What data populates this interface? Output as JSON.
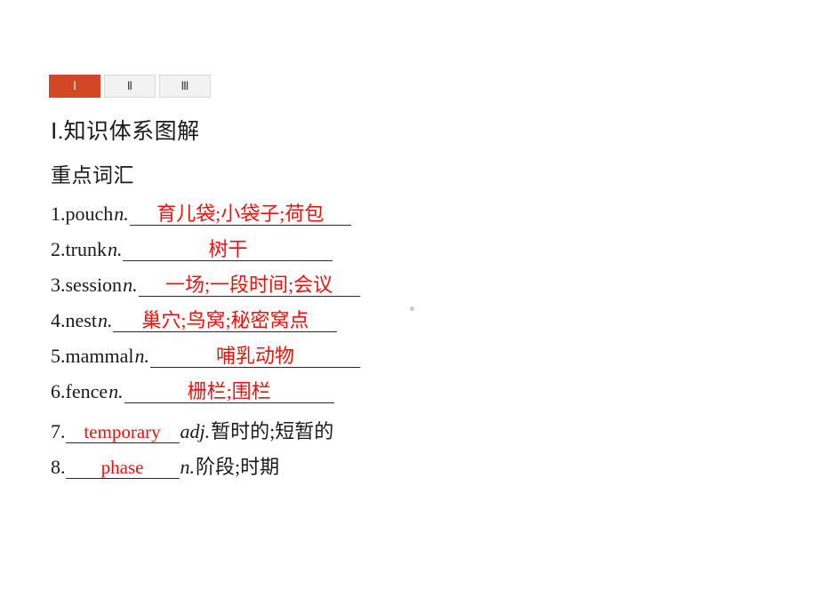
{
  "tabs": [
    {
      "label": "Ⅰ",
      "state": "active"
    },
    {
      "label": "Ⅱ",
      "state": "inactive"
    },
    {
      "label": "Ⅲ",
      "state": "inactive"
    }
  ],
  "headings": {
    "section_title": "Ⅰ.知识体系图解",
    "sub_title": "重点词汇"
  },
  "colors": {
    "active_tab_bg": "#d24726",
    "inactive_tab_bg": "#f2f2f2",
    "answer_red": "#e8140c",
    "text_dark": "#1a1a1a"
  },
  "vocab": [
    {
      "num": "1.",
      "word": "pouch",
      "pos": "n.",
      "answer": "育儿袋;小袋子;荷包",
      "answer_kind": "cn",
      "tail": "",
      "blank_width": 245
    },
    {
      "num": "2.",
      "word": "trunk",
      "pos": "n.",
      "answer": "树干",
      "answer_kind": "cn",
      "tail": "",
      "blank_width": 232
    },
    {
      "num": "3.",
      "word": "session",
      "pos": "n.",
      "answer": "一场;一段时间;会议",
      "answer_kind": "cn",
      "tail": "",
      "blank_width": 245
    },
    {
      "num": "4.",
      "word": "nest",
      "pos": "n.",
      "answer": "巢穴;鸟窝;秘密窝点",
      "answer_kind": "cn",
      "tail": "",
      "blank_width": 248
    },
    {
      "num": "5.",
      "word": "mammal",
      "pos": "n.",
      "answer": "哺乳动物",
      "answer_kind": "cn",
      "tail": "",
      "blank_width": 232
    },
    {
      "num": "6.",
      "word": "fence",
      "pos": "n.",
      "answer": "栅栏;围栏",
      "answer_kind": "cn",
      "tail": "",
      "blank_width": 232
    },
    {
      "num": "7.",
      "word": "",
      "pos": "adj.",
      "answer": "temporary",
      "answer_kind": "en",
      "tail": "暂时的;短暂的",
      "blank_width": 124
    },
    {
      "num": "8.",
      "word": "",
      "pos": "n.",
      "answer": "phase",
      "answer_kind": "en",
      "tail": "阶段;时期",
      "blank_width": 124
    }
  ]
}
